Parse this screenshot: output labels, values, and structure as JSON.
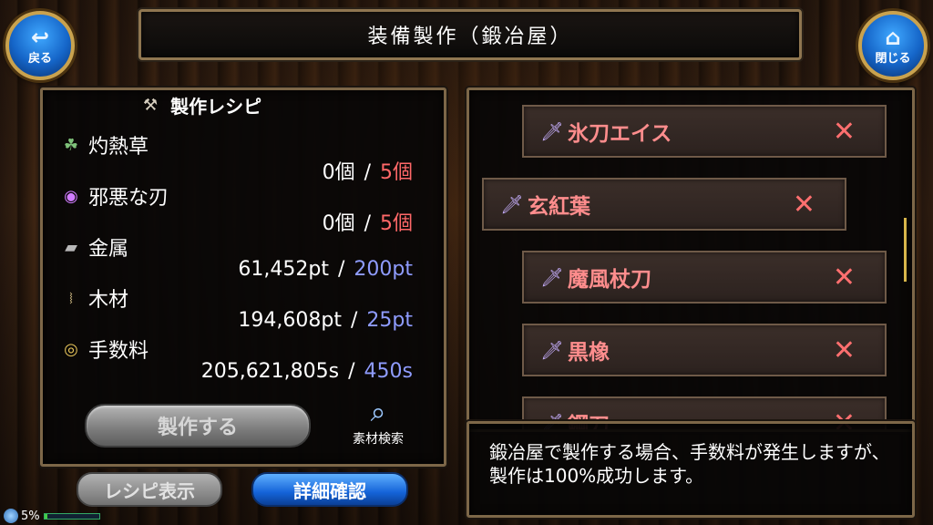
{
  "header": {
    "title": "装備製作（鍛冶屋）",
    "back_label": "戻る",
    "close_label": "閉じる"
  },
  "recipe": {
    "title": "製作レシピ",
    "materials": [
      {
        "name": "灼熱草",
        "have": "0個",
        "need": "5個",
        "need_color": "red",
        "icon": "herb-icon",
        "glyph": "☘"
      },
      {
        "name": "邪悪な刃",
        "have": "0個",
        "need": "5個",
        "need_color": "red",
        "icon": "orb-icon",
        "glyph": "◉"
      },
      {
        "name": "金属",
        "have": "61,452pt",
        "need": "200pt",
        "need_color": "blue",
        "icon": "metal-ingot-icon",
        "glyph": "▰"
      },
      {
        "name": "木材",
        "have": "194,608pt",
        "need": "25pt",
        "need_color": "blue",
        "icon": "wood-icon",
        "glyph": "⧘"
      },
      {
        "name": "手数料",
        "have": "205,621,805s",
        "need": "450s",
        "need_color": "blue",
        "icon": "coins-icon",
        "glyph": "◎"
      }
    ],
    "separator": "/",
    "craft_label": "製作する",
    "search_label": "素材検索"
  },
  "bottom_buttons": {
    "recipe_view": "レシピ表示",
    "detail": "詳細確認"
  },
  "items": [
    {
      "name": "氷刀エイス"
    },
    {
      "name": "玄紅葉"
    },
    {
      "name": "魔風杖刀"
    },
    {
      "name": "黒橡"
    },
    {
      "name": "鋼刀"
    }
  ],
  "message": "鍛冶屋で製作する場合、手数料が発生しますが、製作は100%成功します。",
  "status": {
    "progress_text": "5%",
    "progress_value": 0.05
  },
  "colors": {
    "accent_red": "#ff6868",
    "accent_blue": "#8f9cff",
    "item_red": "#ff8d8d",
    "frame_gold": "#8f7650"
  }
}
